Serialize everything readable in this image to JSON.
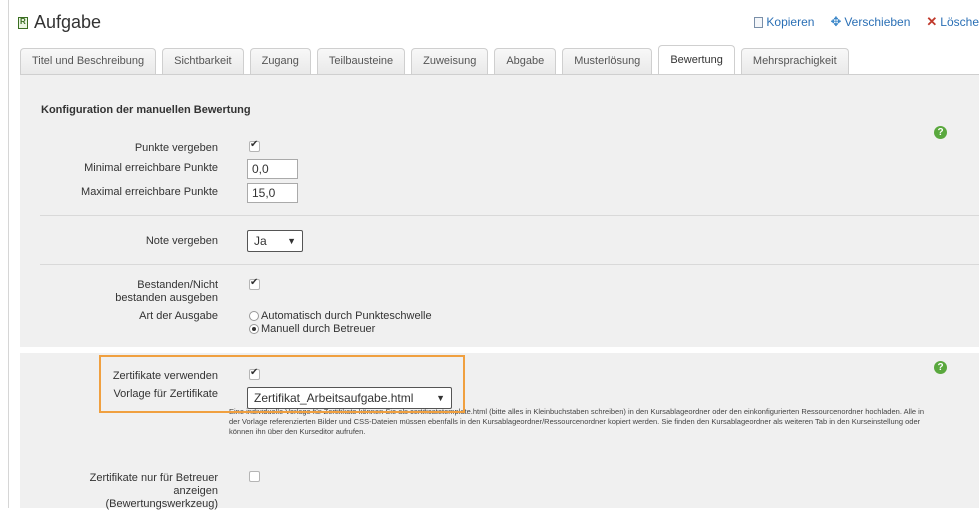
{
  "header": {
    "title": "Aufgabe"
  },
  "actions": {
    "copy": "Kopieren",
    "move": "Verschieben",
    "delete": "Lösche"
  },
  "tabs": [
    {
      "label": "Titel und Beschreibung"
    },
    {
      "label": "Sichtbarkeit"
    },
    {
      "label": "Zugang"
    },
    {
      "label": "Teilbausteine"
    },
    {
      "label": "Zuweisung"
    },
    {
      "label": "Abgabe"
    },
    {
      "label": "Musterlösung"
    },
    {
      "label": "Bewertung",
      "active": true
    },
    {
      "label": "Mehrsprachigkeit"
    }
  ],
  "section": {
    "title": "Konfiguration der manuellen Bewertung",
    "points_label": "Punkte vergeben",
    "points_checked": true,
    "min_label": "Minimal erreichbare Punkte",
    "min_value": "0,0",
    "max_label": "Maximal erreichbare Punkte",
    "max_value": "15,0",
    "grade_label": "Note vergeben",
    "grade_value": "Ja",
    "passed_label": "Bestanden/Nicht bestanden ausgeben",
    "passed_checked": true,
    "output_label": "Art der Ausgabe",
    "output_options": [
      "Automatisch durch Punkteschwelle",
      "Manuell durch Betreuer"
    ],
    "output_selected": "Manuell durch Betreuer"
  },
  "certificate": {
    "use_label": "Zertifikate verwenden",
    "use_checked": true,
    "template_label": "Vorlage für Zertifikate",
    "template_value": "Zertifikat_Arbeitsaufgabe.html",
    "hint": "Eine individuelle Vorlage für Zertifikate können Sie als certificatetemplate.html (bitte alles in Kleinbuchstaben schreiben) in den Kursablageordner oder den einkonfigurierten Ressourcenordner hochladen. Alle in der Vorlage referenzierten Bilder und CSS-Dateien müssen ebenfalls in den Kursablageordner/Ressourcenordner kopiert werden. Sie finden den Kursablageordner als weiteren Tab in den Kurseinstellung oder können ihn über den Kurseditor aufrufen.",
    "coach_only_label": "Zertifikate nur für Betreuer anzeigen (Bewertungswerkzeug)",
    "coach_only_checked": false
  },
  "icons": {
    "help": "help-icon",
    "copy": "copy-icon",
    "move": "move-icon",
    "delete": "delete-icon"
  },
  "colors": {
    "link": "#2a6fb5",
    "help": "#5aa83e",
    "highlight": "#f0a040"
  }
}
